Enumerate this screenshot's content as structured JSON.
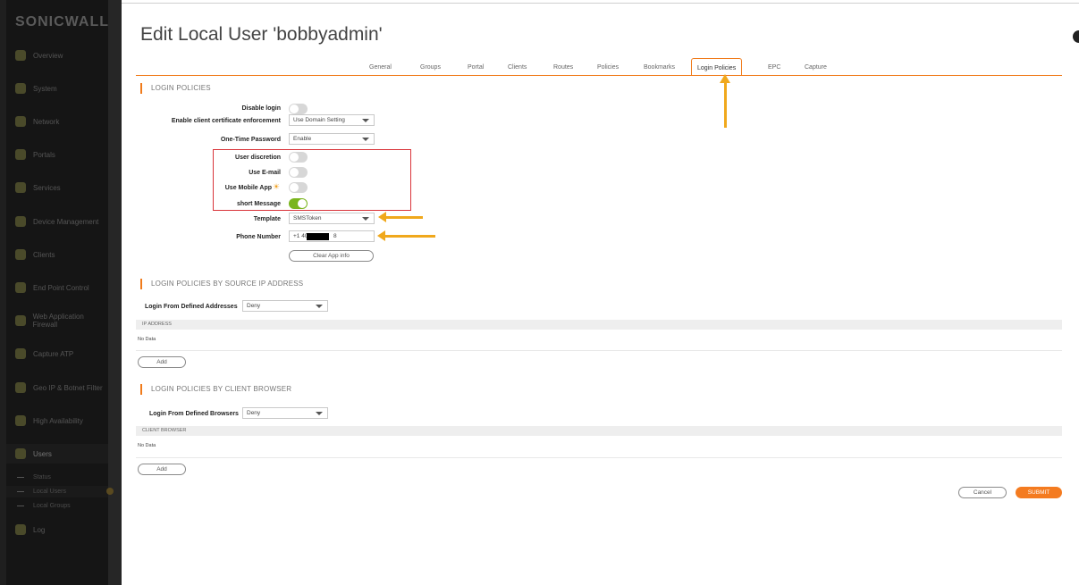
{
  "app": {
    "logo": "SONICWALL",
    "title": "Edit Local User 'bobbyadmin'"
  },
  "sidebar": {
    "items": [
      {
        "label": "Overview"
      },
      {
        "label": "System"
      },
      {
        "label": "Network"
      },
      {
        "label": "Portals"
      },
      {
        "label": "Services"
      },
      {
        "label": "Device Management"
      },
      {
        "label": "Clients"
      },
      {
        "label": "End Point Control"
      },
      {
        "label": "Web Application Firewall"
      },
      {
        "label": "Capture ATP"
      },
      {
        "label": "Geo IP & Botnet Filter"
      },
      {
        "label": "High Availability"
      },
      {
        "label": "Users"
      }
    ],
    "sub_items": [
      {
        "label": "Status"
      },
      {
        "label": "Local Users"
      },
      {
        "label": "Local Groups"
      }
    ],
    "log": {
      "label": "Log"
    }
  },
  "tabs": [
    {
      "label": "General"
    },
    {
      "label": "Groups"
    },
    {
      "label": "Portal"
    },
    {
      "label": "Clients"
    },
    {
      "label": "Routes"
    },
    {
      "label": "Policies"
    },
    {
      "label": "Bookmarks"
    },
    {
      "label": "Login Policies",
      "active": true
    },
    {
      "label": "EPC"
    },
    {
      "label": "Capture"
    }
  ],
  "login_policies": {
    "header": "LOGIN POLICIES",
    "disable_login": {
      "label": "Disable login",
      "on": false
    },
    "cert_enforcement": {
      "label": "Enable client certificate enforcement",
      "value": "Use Domain Setting"
    },
    "otp": {
      "label": "One-Time Password",
      "value": "Enable"
    },
    "user_discretion": {
      "label": "User discretion",
      "on": false
    },
    "use_email": {
      "label": "Use E-mail",
      "on": false
    },
    "use_mobile_app": {
      "label": "Use Mobile App",
      "on": false
    },
    "short_message": {
      "label": "short Message",
      "on": true
    },
    "template": {
      "label": "Template",
      "value": "SMSToken"
    },
    "phone_number": {
      "label": "Phone Number",
      "value_prefix": "+1 40",
      "value_suffix": "8"
    },
    "clear_app_info": "Clear App info"
  },
  "source_ip": {
    "header": "LOGIN POLICIES BY SOURCE IP ADDRESS",
    "label": "Login From Defined Addresses",
    "value": "Deny",
    "column": "IP ADDRESS",
    "empty": "No Data",
    "add": "Add"
  },
  "client_browser": {
    "header": "LOGIN POLICIES BY CLIENT BROWSER",
    "label": "Login From Defined Browsers",
    "value": "Deny",
    "column": "CLIENT BROWSER",
    "empty": "No Data",
    "add": "Add"
  },
  "footer": {
    "cancel": "Cancel",
    "submit": "SUBMIT"
  },
  "colors": {
    "accent": "#f07b1b",
    "toggle_on": "#7ab51d",
    "annotation_arrow": "#f0a81c",
    "annotation_box": "#d9343a"
  }
}
